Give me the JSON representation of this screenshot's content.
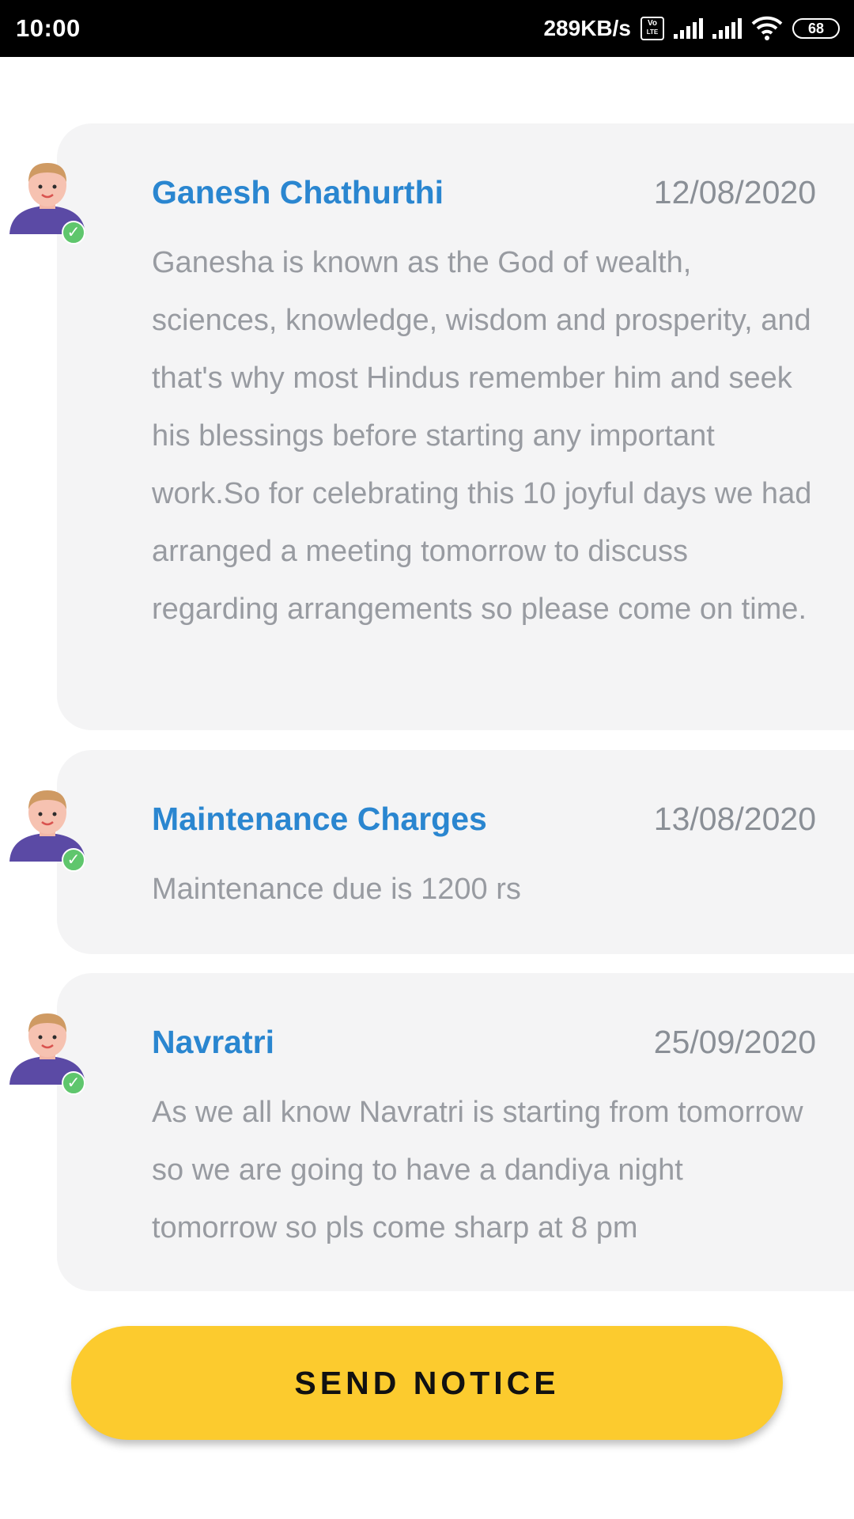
{
  "status_bar": {
    "time": "10:00",
    "speed": "289KB/s",
    "volte_top": "Vo",
    "volte_bottom": "LTE",
    "battery": "68"
  },
  "notices": [
    {
      "title": "Ganesh Chathurthi",
      "date": "12/08/2020",
      "body": "Ganesha is known as the God of wealth, sciences, knowledge, wisdom and prosperity, and that's why most Hindus remember him and seek his blessings before starting any important work.So for celebrating this 10 joyful days we had arranged a meeting tomorrow to discuss regarding arrangements so please come on time."
    },
    {
      "title": "Maintenance Charges",
      "date": "13/08/2020",
      "body": "Maintenance due is 1200 rs"
    },
    {
      "title": "Navratri",
      "date": "25/09/2020",
      "body": "As we all know Navratri is starting from tomorrow so we are going to have a dandiya night tomorrow so pls come sharp at 8 pm"
    }
  ],
  "send_button": {
    "label": "SEND NOTICE"
  },
  "colors": {
    "title": "#2a86d0",
    "card_bg": "#f4f4f5",
    "button": "#fccb2e",
    "check": "#5fc66d"
  }
}
